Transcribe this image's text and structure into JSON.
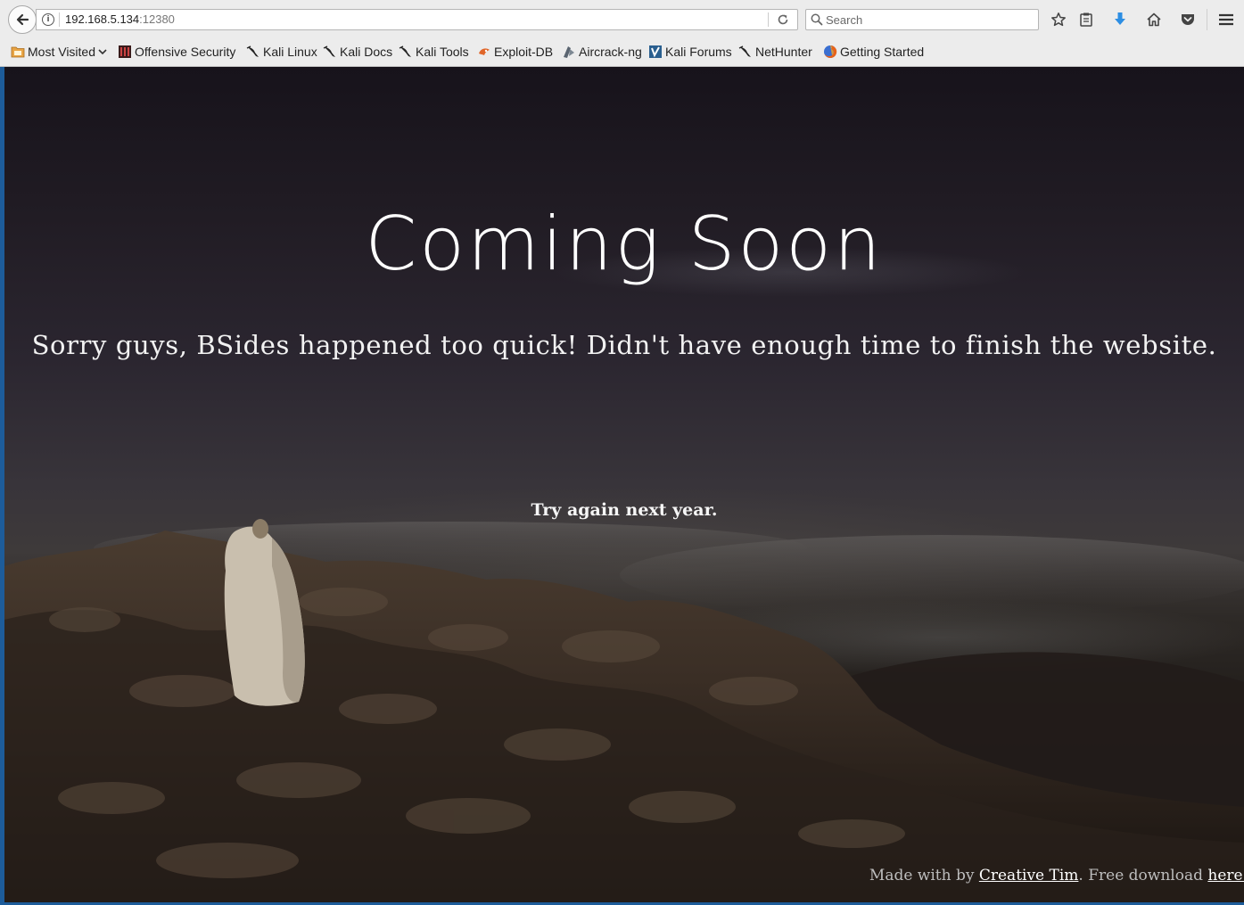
{
  "browser": {
    "url_host": "192.168.5.134",
    "url_port": ":12380",
    "search_placeholder": "Search"
  },
  "bookmarks": [
    {
      "label": "Most Visited",
      "icon": "folder-icon"
    },
    {
      "label": "Offensive Security",
      "icon": "offsec-icon"
    },
    {
      "label": "Kali Linux",
      "icon": "kali-dragon-icon"
    },
    {
      "label": "Kali Docs",
      "icon": "kali-dragon-icon"
    },
    {
      "label": "Kali Tools",
      "icon": "kali-dragon-icon"
    },
    {
      "label": "Exploit-DB",
      "icon": "exploitdb-icon"
    },
    {
      "label": "Aircrack-ng",
      "icon": "aircrack-icon"
    },
    {
      "label": "Kali Forums",
      "icon": "kali-forums-icon"
    },
    {
      "label": "NetHunter",
      "icon": "kali-dragon-icon"
    },
    {
      "label": "Getting Started",
      "icon": "firefox-icon"
    }
  ],
  "page": {
    "headline": "Coming Soon",
    "subtitle": "Sorry guys, BSides happened too quick! Didn't have enough time to finish the website.",
    "tagline": "Try again next year.",
    "footer": {
      "prefix": "Made with by ",
      "author_link": "Creative Tim",
      "middle": ". Free download ",
      "download_link": "here."
    }
  },
  "colors": {
    "accent": "#1d5c9a",
    "download_arrow": "#2d8ee3"
  }
}
